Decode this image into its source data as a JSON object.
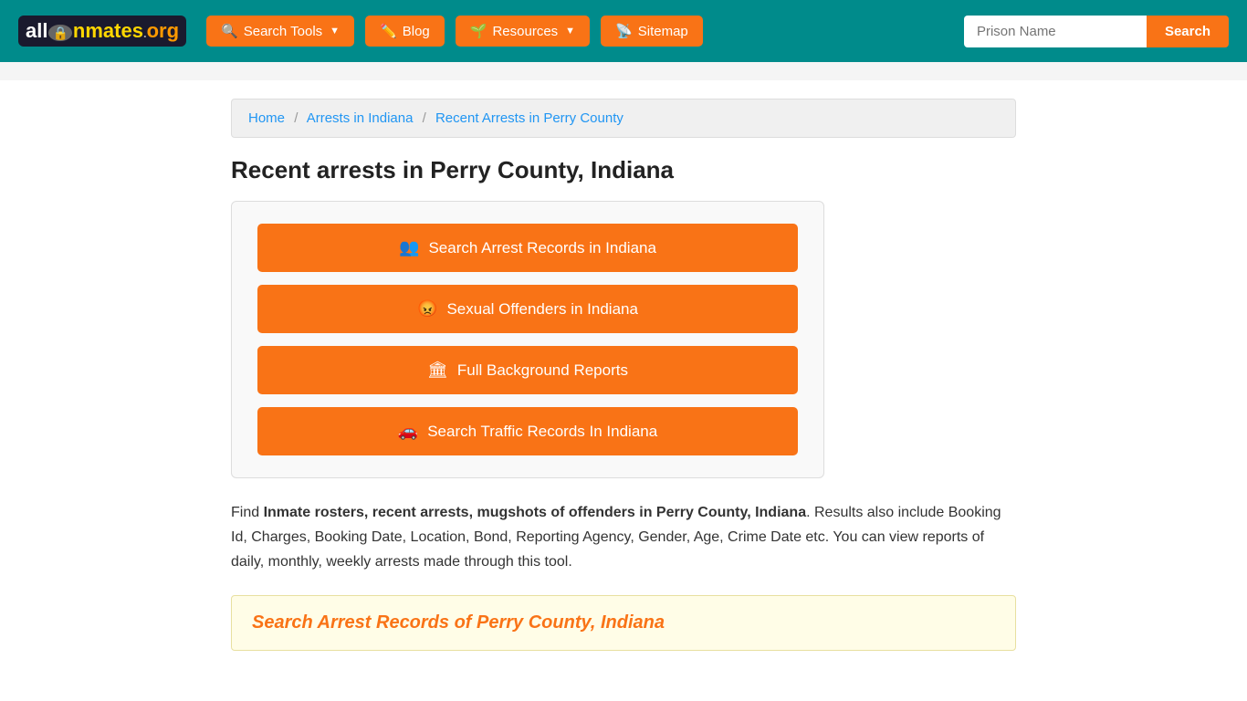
{
  "header": {
    "logo": {
      "text_all": "all",
      "text_inmates": "Inmates",
      "text_org": ".org"
    },
    "nav": [
      {
        "id": "search-tools",
        "label": "Search Tools",
        "icon": "🔍",
        "has_arrow": true
      },
      {
        "id": "blog",
        "label": "Blog",
        "icon": "✏️",
        "has_arrow": false
      },
      {
        "id": "resources",
        "label": "Resources",
        "icon": "🌱",
        "has_arrow": true
      },
      {
        "id": "sitemap",
        "label": "Sitemap",
        "icon": "📡",
        "has_arrow": false
      }
    ],
    "search_placeholder": "Prison Name",
    "search_button_label": "Search"
  },
  "breadcrumb": {
    "home": "Home",
    "arrests": "Arrests in Indiana",
    "current": "Recent Arrests in Perry County"
  },
  "page_title": "Recent arrests in Perry County, Indiana",
  "action_buttons": [
    {
      "id": "arrest-records",
      "icon": "👥",
      "label": "Search Arrest Records in Indiana"
    },
    {
      "id": "sexual-offenders",
      "icon": "😡",
      "label": "Sexual Offenders in Indiana"
    },
    {
      "id": "background-reports",
      "icon": "🏛",
      "label": "Full Background Reports"
    },
    {
      "id": "traffic-records",
      "icon": "🚗",
      "label": "Search Traffic Records In Indiana"
    }
  ],
  "description": {
    "bold_part": "Inmate rosters, recent arrests, mugshots of offenders in Perry County, Indiana",
    "normal_part": ". Results also include Booking Id, Charges, Booking Date, Location, Bond, Reporting Agency, Gender, Age, Crime Date etc. You can view reports of daily, monthly, weekly arrests made through this tool."
  },
  "search_section_title": "Search Arrest Records of Perry County, Indiana"
}
